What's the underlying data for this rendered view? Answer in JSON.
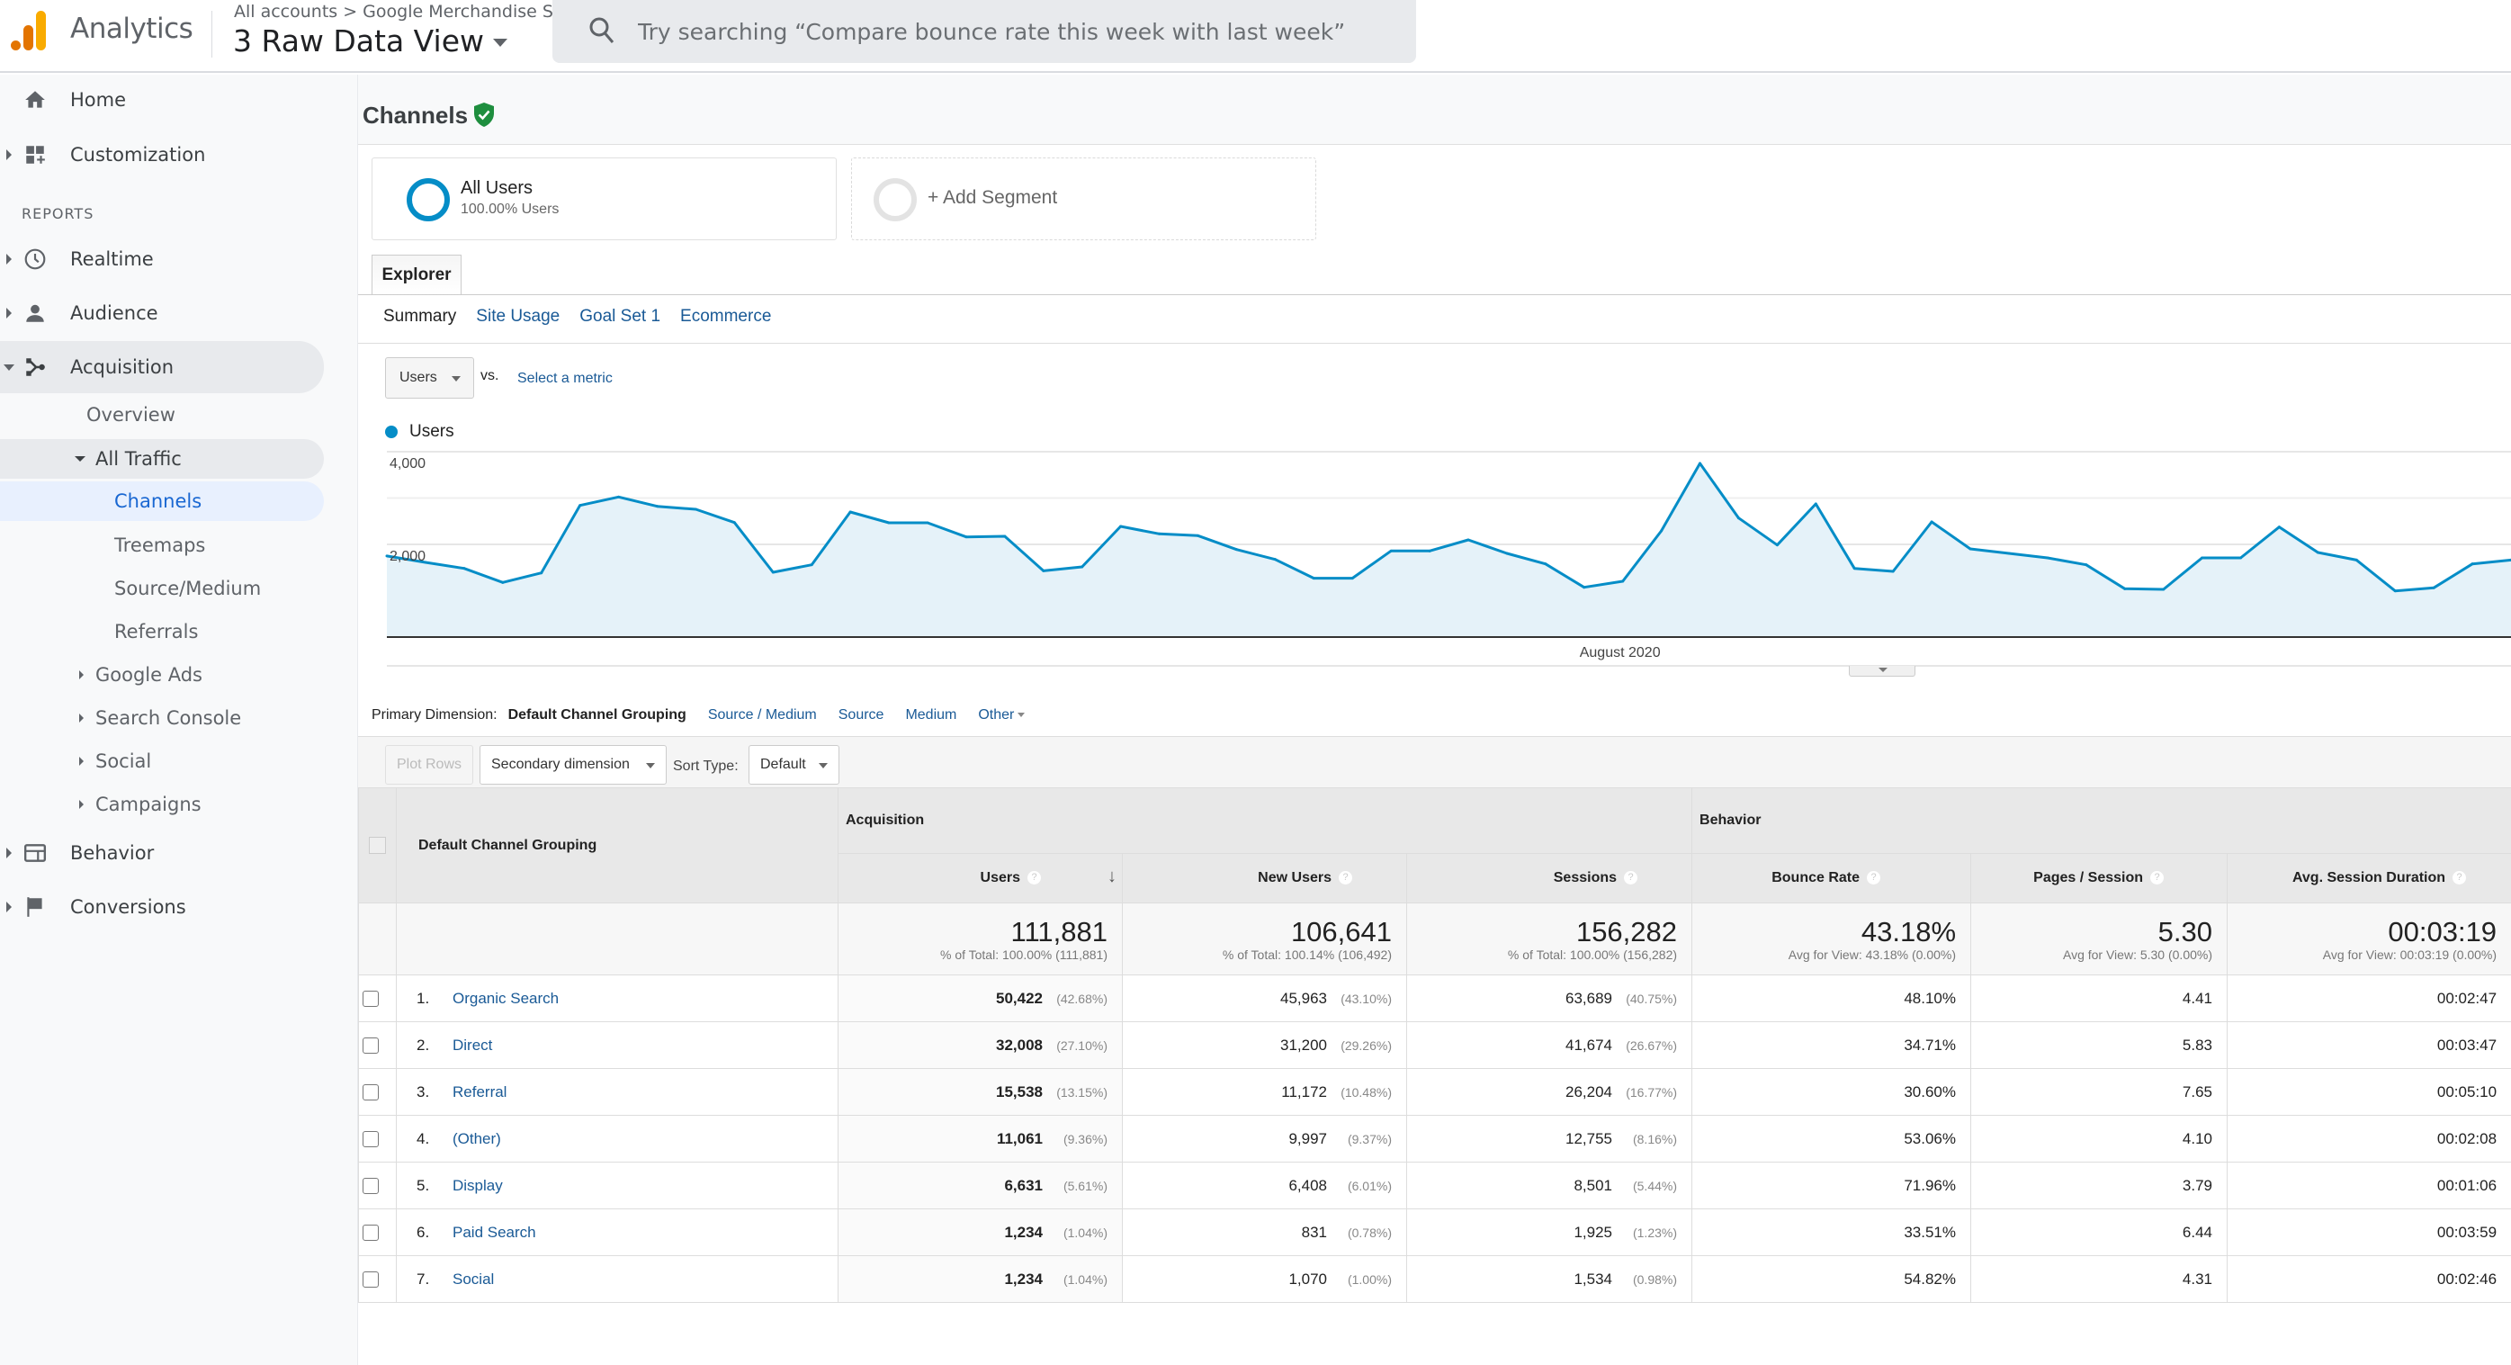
{
  "header": {
    "app_title": "Analytics",
    "breadcrumb": "All accounts > Google Merchandise St...",
    "view_name": "3 Raw Data View",
    "search_placeholder": "Try searching “Compare bounce rate this week with last week”"
  },
  "sidebar": {
    "top_items": [
      {
        "label": "Home",
        "icon": "home-icon"
      },
      {
        "label": "Customization",
        "icon": "dashboard-customize-icon"
      }
    ],
    "reports_label": "REPORTS",
    "report_items": [
      {
        "label": "Realtime",
        "icon": "clock-icon"
      },
      {
        "label": "Audience",
        "icon": "person-icon"
      },
      {
        "label": "Acquisition",
        "icon": "acquisition-icon"
      }
    ],
    "acquisition_children": {
      "overview": "Overview",
      "all_traffic": "All Traffic",
      "all_traffic_children": [
        "Channels",
        "Treemaps",
        "Source/Medium",
        "Referrals"
      ],
      "groups": [
        "Google Ads",
        "Search Console",
        "Social",
        "Campaigns"
      ]
    },
    "bottom_items": [
      {
        "label": "Behavior",
        "icon": "behavior-icon"
      },
      {
        "label": "Conversions",
        "icon": "flag-icon"
      }
    ],
    "selected": "Channels"
  },
  "page": {
    "title": "Channels",
    "segments": {
      "active_name": "All Users",
      "active_sub": "100.00% Users",
      "add_label": "+ Add Segment"
    },
    "explorer_tab": "Explorer",
    "subtabs": [
      "Summary",
      "Site Usage",
      "Goal Set 1",
      "Ecommerce"
    ],
    "active_subtab": "Summary",
    "metric": {
      "selected": "Users",
      "vs_label": "vs.",
      "compare_placeholder": "Select a metric"
    }
  },
  "chart_data": {
    "type": "area",
    "title": "",
    "legend": [
      "Users"
    ],
    "legend_position": "top-left",
    "series": [
      {
        "name": "Users",
        "color": "#058dc7",
        "values": [
          1750,
          1612,
          1482,
          1178,
          1384,
          2841,
          3023,
          2822,
          2757,
          2472,
          1398,
          1560,
          2699,
          2466,
          2466,
          2162,
          2175,
          1430,
          1515,
          2388,
          2227,
          2188,
          1890,
          1676,
          1269,
          1269,
          1858,
          1858,
          2097,
          1806,
          1579,
          1074,
          1204,
          2291,
          3748,
          2569,
          1987,
          2874,
          1482,
          1417,
          2485,
          1903,
          1806,
          1709,
          1560,
          1042,
          1029,
          1709,
          1709,
          2375,
          1825,
          1663,
          997,
          1062,
          1579,
          1663
        ]
      }
    ],
    "x_label_text": "August 2020",
    "x_label_index": 31,
    "y_ticks": [
      {
        "value": 4000,
        "label": "4,000"
      },
      {
        "value": 2000,
        "label": "2,000"
      }
    ],
    "y_gridlines": [
      1000,
      2000,
      3000,
      4000
    ],
    "ylim": [
      0,
      4000
    ],
    "xlabel": "",
    "ylabel": "",
    "grid": true
  },
  "table_controls": {
    "primary_dimension_label": "Primary Dimension:",
    "primary_dimension_current": "Default Channel Grouping",
    "primary_dimension_options": [
      "Source / Medium",
      "Source",
      "Medium",
      "Other"
    ],
    "plot_rows": "Plot Rows",
    "secondary_dimension": "Secondary dimension",
    "sort_type_label": "Sort Type:",
    "sort_type_value": "Default"
  },
  "table": {
    "dimension_header": "Default Channel Grouping",
    "group_headers": [
      "Acquisition",
      "Behavior"
    ],
    "columns": [
      "Users",
      "New Users",
      "Sessions",
      "Bounce Rate",
      "Pages / Session",
      "Avg. Session Duration"
    ],
    "sorted_column": "Users",
    "totals": [
      {
        "value": "111,881",
        "sub": "% of Total: 100.00% (111,881)"
      },
      {
        "value": "106,641",
        "sub": "% of Total: 100.14% (106,492)"
      },
      {
        "value": "156,282",
        "sub": "% of Total: 100.00% (156,282)"
      },
      {
        "value": "43.18%",
        "sub": "Avg for View: 43.18% (0.00%)"
      },
      {
        "value": "5.30",
        "sub": "Avg for View: 5.30 (0.00%)"
      },
      {
        "value": "00:03:19",
        "sub": "Avg for View: 00:03:19 (0.00%)"
      }
    ],
    "rows": [
      {
        "idx": "1.",
        "channel": "Organic Search",
        "users": "50,422",
        "users_pct": "(42.68%)",
        "new_users": "45,963",
        "new_users_pct": "(43.10%)",
        "sessions": "63,689",
        "sessions_pct": "(40.75%)",
        "bounce": "48.10%",
        "pages": "4.41",
        "duration": "00:02:47"
      },
      {
        "idx": "2.",
        "channel": "Direct",
        "users": "32,008",
        "users_pct": "(27.10%)",
        "new_users": "31,200",
        "new_users_pct": "(29.26%)",
        "sessions": "41,674",
        "sessions_pct": "(26.67%)",
        "bounce": "34.71%",
        "pages": "5.83",
        "duration": "00:03:47"
      },
      {
        "idx": "3.",
        "channel": "Referral",
        "users": "15,538",
        "users_pct": "(13.15%)",
        "new_users": "11,172",
        "new_users_pct": "(10.48%)",
        "sessions": "26,204",
        "sessions_pct": "(16.77%)",
        "bounce": "30.60%",
        "pages": "7.65",
        "duration": "00:05:10"
      },
      {
        "idx": "4.",
        "channel": "(Other)",
        "users": "11,061",
        "users_pct": "(9.36%)",
        "new_users": "9,997",
        "new_users_pct": "(9.37%)",
        "sessions": "12,755",
        "sessions_pct": "(8.16%)",
        "bounce": "53.06%",
        "pages": "4.10",
        "duration": "00:02:08"
      },
      {
        "idx": "5.",
        "channel": "Display",
        "users": "6,631",
        "users_pct": "(5.61%)",
        "new_users": "6,408",
        "new_users_pct": "(6.01%)",
        "sessions": "8,501",
        "sessions_pct": "(5.44%)",
        "bounce": "71.96%",
        "pages": "3.79",
        "duration": "00:01:06"
      },
      {
        "idx": "6.",
        "channel": "Paid Search",
        "users": "1,234",
        "users_pct": "(1.04%)",
        "new_users": "831",
        "new_users_pct": "(0.78%)",
        "sessions": "1,925",
        "sessions_pct": "(1.23%)",
        "bounce": "33.51%",
        "pages": "6.44",
        "duration": "00:03:59"
      },
      {
        "idx": "7.",
        "channel": "Social",
        "users": "1,234",
        "users_pct": "(1.04%)",
        "new_users": "1,070",
        "new_users_pct": "(1.00%)",
        "sessions": "1,534",
        "sessions_pct": "(0.98%)",
        "bounce": "54.82%",
        "pages": "4.31",
        "duration": "00:02:46"
      }
    ]
  },
  "colors": {
    "accent_blue": "#058dc7",
    "link_blue": "#1a5a96",
    "nav_selected": "#1967d2",
    "verified_green": "#1e8e3e",
    "logo_orange": "#e37400",
    "logo_yellow": "#f9ab00"
  }
}
